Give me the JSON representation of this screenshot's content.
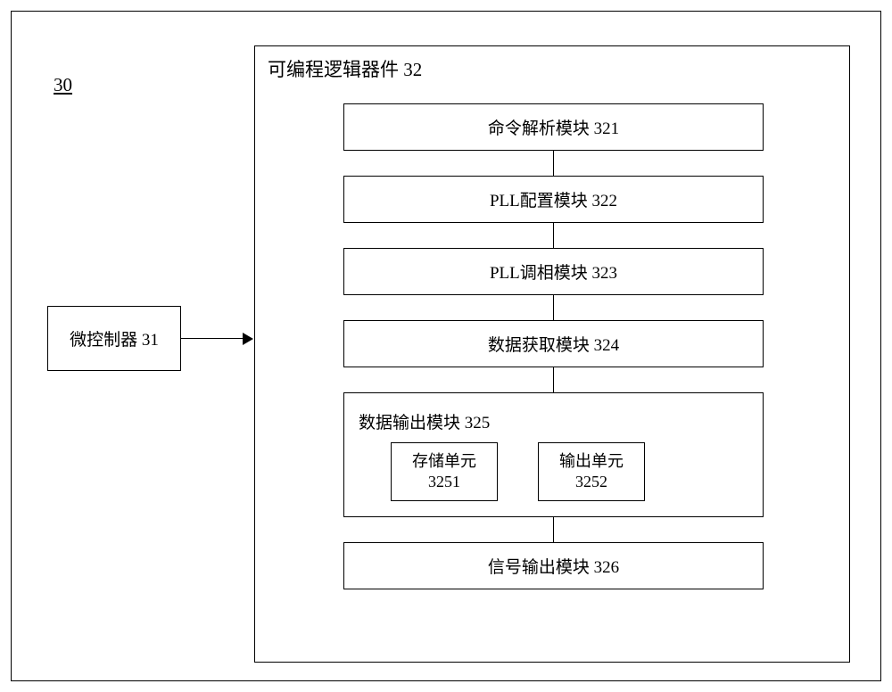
{
  "diagram_id": "30",
  "mcu": {
    "label": "微控制器  31"
  },
  "pld": {
    "title": "可编程逻辑器件  32",
    "modules": {
      "m321": "命令解析模块  321",
      "m322": "PLL配置模块  322",
      "m323": "PLL调相模块  323",
      "m324": "数据获取模块  324",
      "m325": {
        "title": "数据输出模块  325",
        "sub3251": {
          "name": "存储单元",
          "id": "3251"
        },
        "sub3252": {
          "name": "输出单元",
          "id": "3252"
        }
      },
      "m326": "信号输出模块  326"
    }
  }
}
